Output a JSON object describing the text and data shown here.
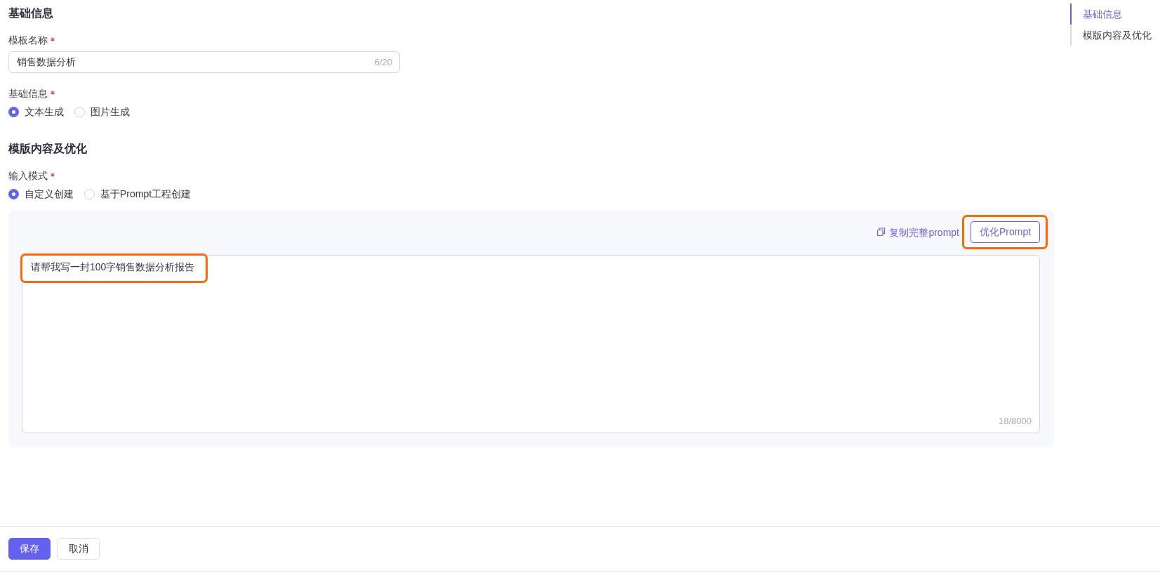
{
  "sections": [
    {
      "title": "基础信息",
      "fields": [
        {
          "kind": "text",
          "label": "模板名称",
          "required": true,
          "value": "销售数据分析",
          "counter": "6/20"
        },
        {
          "kind": "radio",
          "label": "基础信息",
          "required": true,
          "options": [
            {
              "label": "文本生成",
              "selected": true
            },
            {
              "label": "图片生成",
              "selected": false
            }
          ]
        }
      ]
    },
    {
      "title": "模版内容及优化",
      "fields": [
        {
          "kind": "radio",
          "label": "输入模式",
          "required": true,
          "options": [
            {
              "label": "自定义创建",
              "selected": true
            },
            {
              "label": "基于Prompt工程创建",
              "selected": false
            }
          ]
        },
        {
          "kind": "editor",
          "copy_link": "复制完整prompt",
          "optimize_button": {
            "label": "优化Prompt",
            "highlighted": true
          },
          "prompt": {
            "value": "请帮我写一封100字销售数据分析报告",
            "highlighted": true
          },
          "counter": "18/8000"
        }
      ]
    }
  ],
  "anchor_nav": {
    "items": [
      {
        "label": "基础信息",
        "selected": true
      },
      {
        "label": "模版内容及优化",
        "selected": false
      }
    ]
  },
  "footer": {
    "buttons": [
      {
        "kind": "primary",
        "label": "保存"
      },
      {
        "kind": "default",
        "label": "取消"
      }
    ]
  }
}
